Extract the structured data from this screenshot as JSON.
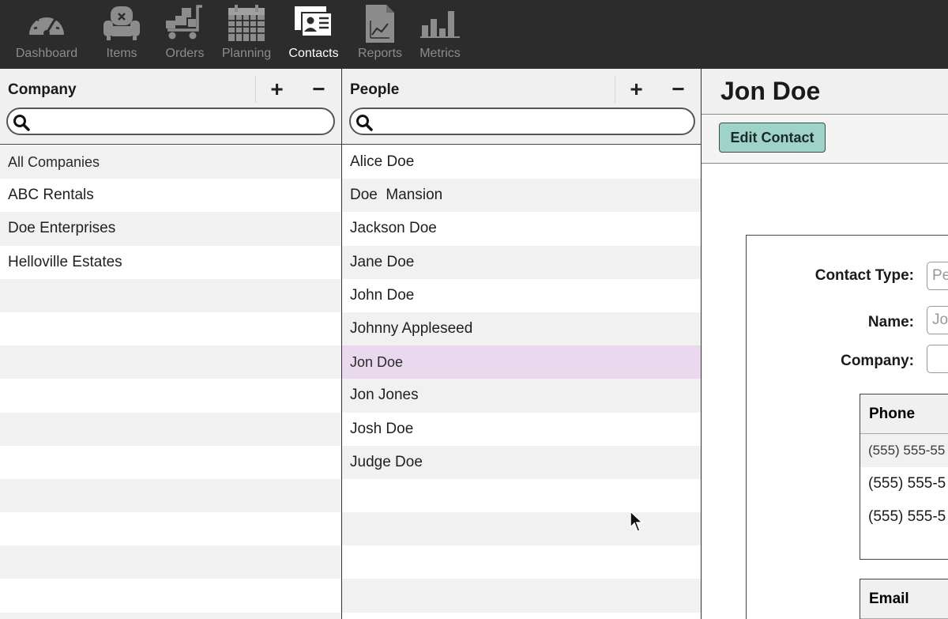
{
  "toolbar": {
    "items": [
      {
        "label": "Dashboard",
        "icon": "speedometer-icon"
      },
      {
        "label": "Items",
        "icon": "armchair-icon"
      },
      {
        "label": "Orders",
        "icon": "hand-truck-icon"
      },
      {
        "label": "Planning",
        "icon": "calendar-icon"
      },
      {
        "label": "Contacts",
        "icon": "contact-card-icon"
      },
      {
        "label": "Reports",
        "icon": "report-chart-icon"
      },
      {
        "label": "Metrics",
        "icon": "bar-metrics-icon"
      }
    ],
    "active": "Contacts"
  },
  "company": {
    "title": "Company",
    "add_label": "+",
    "remove_label": "−",
    "search_placeholder": "",
    "items": [
      "All Companies",
      "ABC Rentals",
      "Doe Enterprises",
      "Helloville Estates"
    ]
  },
  "people": {
    "title": "People",
    "add_label": "+",
    "remove_label": "−",
    "search_placeholder": "",
    "items": [
      "Alice Doe",
      "Doe  Mansion",
      "Jackson Doe",
      "Jane Doe",
      "John Doe",
      "Johnny Appleseed",
      "Jon Doe",
      "Jon Jones",
      "Josh Doe",
      "Judge Doe"
    ],
    "selected": "Jon Doe"
  },
  "detail": {
    "title": "Jon Doe",
    "edit_button": "Edit Contact",
    "contact_type_label": "Contact Type:",
    "contact_type_value": "Pe",
    "name_label": "Name:",
    "name_value": "Jo",
    "company_label": "Company:",
    "company_value": "",
    "phone_header": "Phone",
    "phones": [
      "(555) 555-55",
      "(555) 555-5",
      "(555) 555-5"
    ],
    "email_header": "Email"
  },
  "colors": {
    "toolbar_bg": "#2c2c2c",
    "selected_row": "#ead8ee",
    "edit_button": "#9fd3c8"
  }
}
